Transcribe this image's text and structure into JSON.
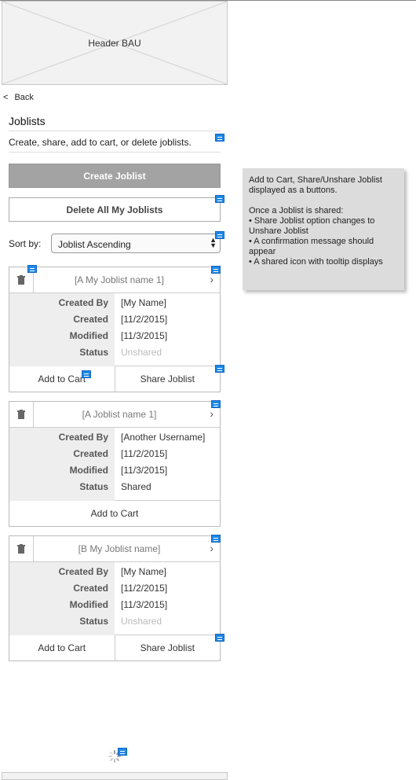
{
  "header": {
    "placeholder_label": "Header BAU"
  },
  "back": {
    "chevron": "<",
    "label": "Back"
  },
  "page": {
    "title": "Joblists",
    "description": "Create, share, add to cart, or delete joblists."
  },
  "buttons": {
    "create": "Create Joblist",
    "delete_all": "Delete All My Joblists"
  },
  "sort": {
    "label": "Sort by:",
    "selected": "Joblist Ascending"
  },
  "field_labels": {
    "created_by": "Created By",
    "created": "Created",
    "modified": "Modified",
    "status": "Status"
  },
  "cards": [
    {
      "title": "[A My Joblist name 1]",
      "created_by": "[My Name]",
      "created": "[11/2/2015]",
      "modified": "[11/3/2015]",
      "status": "Unshared",
      "actions": [
        "Add to Cart",
        "Share Joblist"
      ]
    },
    {
      "title": "[A Joblist name 1]",
      "created_by": "[Another Username]",
      "created": "[11/2/2015]",
      "modified": "[11/3/2015]",
      "status": "Shared",
      "actions": [
        "Add to Cart"
      ]
    },
    {
      "title": "[B My Joblist name]",
      "created_by": "[My Name]",
      "created": "[11/2/2015]",
      "modified": "[11/3/2015]",
      "status": "Unshared",
      "actions": [
        "Add to Cart",
        "Share Joblist"
      ]
    }
  ],
  "annotation": {
    "line1": "Add to Cart, Share/Unshare Joblist displayed as a buttons.",
    "line2": "Once a Joblist is shared:",
    "bullet1": "• Share Joblist option changes to Unshare Joblist",
    "bullet2": "• A confirmation message should appear",
    "bullet3": "• A shared icon with tooltip displays"
  },
  "icons": {
    "note": "note-icon",
    "trash": "trash-icon",
    "chevron": "chevron-right-icon",
    "spinner": "loading-spinner-icon"
  },
  "colors": {
    "note_blue": "#1e88e5",
    "create_button_bg": "#a3a3a3",
    "annotation_bg": "#dcdcdc"
  }
}
